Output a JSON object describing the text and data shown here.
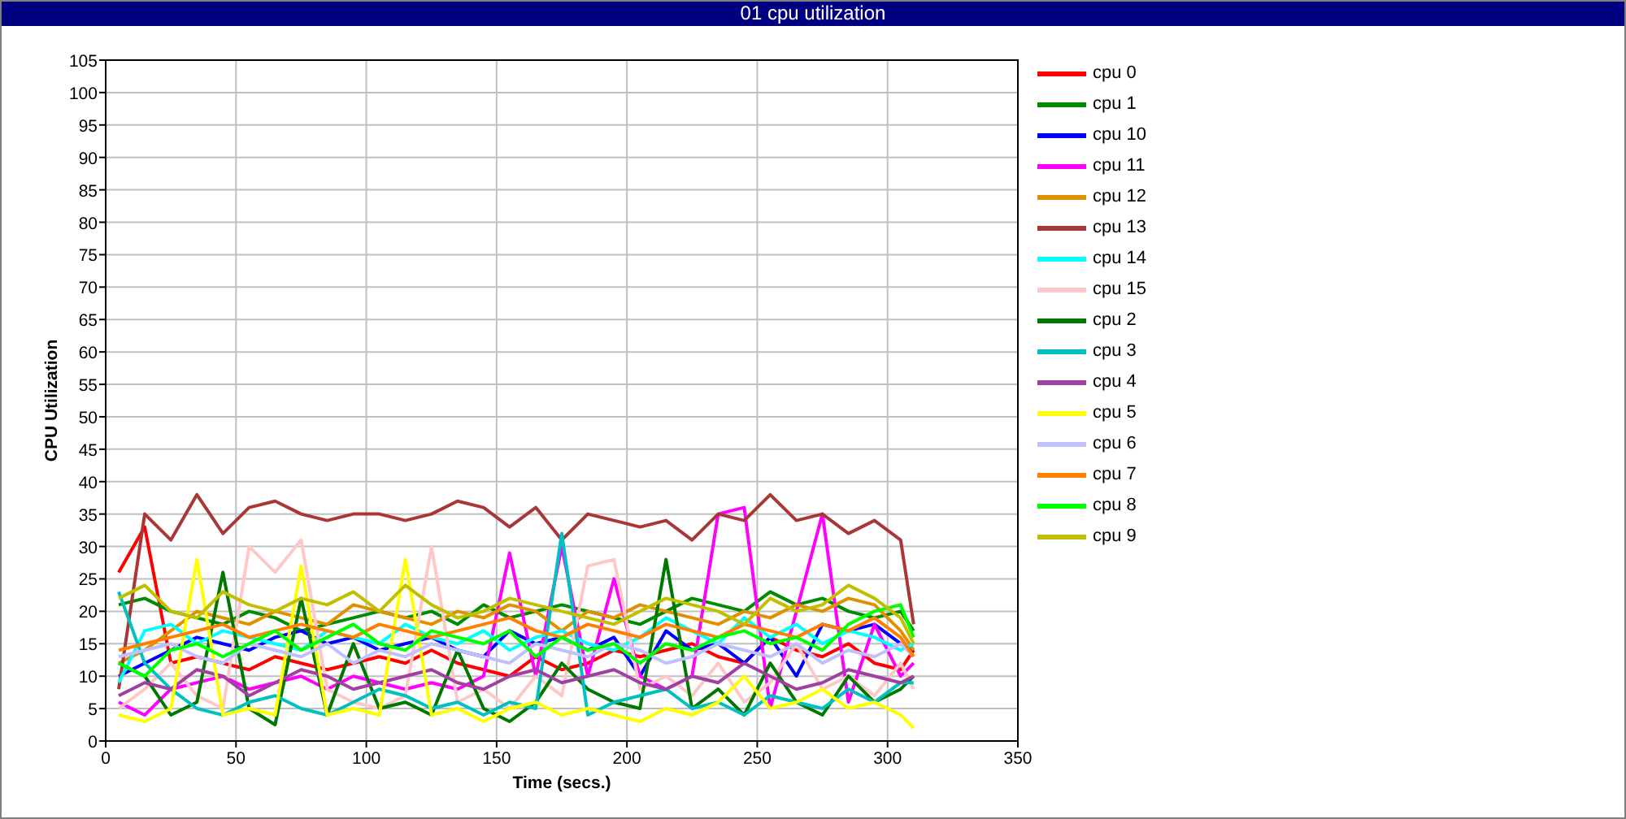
{
  "window": {
    "title": "01 cpu utilization"
  },
  "chart": {
    "chart_data": {
      "type": "line",
      "grid": true,
      "xlabel": "Time (secs.)",
      "ylabel": "CPU Utilization",
      "xlim": [
        0,
        350
      ],
      "ylim": [
        0,
        105
      ],
      "xticks": [
        0,
        50,
        100,
        150,
        200,
        250,
        300,
        350
      ],
      "yticks": [
        0,
        5,
        10,
        15,
        20,
        25,
        30,
        35,
        40,
        45,
        50,
        55,
        60,
        65,
        70,
        75,
        80,
        85,
        90,
        95,
        100,
        105
      ],
      "x": [
        5,
        15,
        25,
        35,
        45,
        55,
        65,
        75,
        85,
        95,
        105,
        115,
        125,
        135,
        145,
        155,
        165,
        175,
        185,
        195,
        205,
        215,
        225,
        235,
        245,
        255,
        265,
        275,
        285,
        295,
        305,
        310
      ],
      "series": [
        {
          "name": "cpu 0",
          "color": "#ff0000",
          "values": [
            26,
            33,
            12,
            13,
            12,
            11,
            13,
            12,
            11,
            12,
            13,
            12,
            14,
            12,
            11,
            10,
            13,
            11,
            12,
            14,
            13,
            14,
            15,
            13,
            12,
            16,
            14,
            13,
            15,
            12,
            11,
            14
          ]
        },
        {
          "name": "cpu 1",
          "color": "#008c00",
          "values": [
            21,
            22,
            20,
            19,
            18,
            20,
            19,
            17,
            18,
            19,
            20,
            19,
            20,
            18,
            21,
            19,
            20,
            21,
            20,
            19,
            18,
            20,
            22,
            21,
            20,
            23,
            21,
            22,
            20,
            19,
            20,
            17
          ]
        },
        {
          "name": "cpu 10",
          "color": "#0000ff",
          "values": [
            10,
            12,
            14,
            16,
            15,
            14,
            16,
            17,
            15,
            16,
            14,
            15,
            16,
            14,
            13,
            17,
            15,
            16,
            14,
            16,
            10,
            17,
            14,
            15,
            12,
            16,
            10,
            18,
            17,
            18,
            15,
            14
          ]
        },
        {
          "name": "cpu 11",
          "color": "#ff00ff",
          "values": [
            6,
            4,
            8,
            9,
            10,
            8,
            9,
            10,
            8,
            10,
            9,
            8,
            9,
            8,
            10,
            29,
            10,
            30,
            10,
            25,
            10,
            8,
            10,
            35,
            36,
            5,
            20,
            35,
            6,
            18,
            10,
            12
          ]
        },
        {
          "name": "cpu 12",
          "color": "#e09000",
          "values": [
            12,
            14,
            17,
            20,
            19,
            18,
            20,
            19,
            18,
            21,
            20,
            19,
            18,
            20,
            19,
            21,
            20,
            17,
            20,
            19,
            21,
            20,
            19,
            18,
            20,
            19,
            21,
            20,
            22,
            21,
            17,
            14
          ]
        },
        {
          "name": "cpu 13",
          "color": "#a83838",
          "values": [
            8,
            35,
            31,
            38,
            32,
            36,
            37,
            35,
            34,
            35,
            35,
            34,
            35,
            37,
            36,
            33,
            36,
            31,
            35,
            34,
            33,
            34,
            31,
            35,
            34,
            38,
            34,
            35,
            32,
            34,
            31,
            18
          ]
        },
        {
          "name": "cpu 14",
          "color": "#00ffff",
          "values": [
            9,
            17,
            18,
            15,
            17,
            16,
            15,
            14,
            17,
            16,
            15,
            18,
            16,
            15,
            17,
            14,
            16,
            17,
            15,
            14,
            16,
            19,
            17,
            15,
            19,
            16,
            18,
            15,
            17,
            16,
            14,
            15
          ]
        },
        {
          "name": "cpu 15",
          "color": "#ffc8c8",
          "values": [
            5,
            8,
            12,
            7,
            5,
            30,
            26,
            31,
            8,
            6,
            5,
            7,
            30,
            6,
            8,
            5,
            10,
            7,
            27,
            28,
            8,
            10,
            7,
            12,
            6,
            9,
            15,
            8,
            10,
            7,
            12,
            8
          ]
        },
        {
          "name": "cpu 2",
          "color": "#007800",
          "values": [
            12,
            10,
            4,
            6,
            26,
            5,
            2.5,
            22,
            4,
            15,
            5,
            6,
            4,
            14,
            5,
            3,
            6,
            12,
            8,
            6,
            5,
            28,
            5,
            8,
            4,
            12,
            6,
            4,
            10,
            6,
            8,
            10
          ]
        },
        {
          "name": "cpu 3",
          "color": "#00c0c0",
          "values": [
            23,
            12,
            8,
            5,
            4,
            6,
            7,
            5,
            4,
            6,
            8,
            7,
            5,
            6,
            4,
            6,
            5,
            32,
            4,
            6,
            7,
            8,
            5,
            6,
            4,
            7,
            6,
            5,
            8,
            6,
            9,
            9
          ]
        },
        {
          "name": "cpu 4",
          "color": "#a040a0",
          "values": [
            7,
            9,
            8,
            11,
            10,
            7,
            9,
            11,
            10,
            8,
            9,
            10,
            11,
            9,
            8,
            10,
            11,
            9,
            10,
            11,
            9,
            8,
            10,
            9,
            12,
            10,
            8,
            9,
            11,
            10,
            9,
            10
          ]
        },
        {
          "name": "cpu 5",
          "color": "#ffff00",
          "values": [
            4,
            3,
            5,
            28,
            4,
            5,
            4,
            27,
            4,
            5,
            4,
            28,
            4,
            5,
            3,
            5,
            6,
            4,
            5,
            4,
            3,
            5,
            4,
            6,
            10,
            5,
            6,
            8,
            5,
            6,
            4,
            2
          ]
        },
        {
          "name": "cpu 6",
          "color": "#c0c0ff",
          "values": [
            13,
            14,
            15,
            13,
            12,
            15,
            14,
            13,
            15,
            12,
            14,
            13,
            15,
            14,
            13,
            12,
            15,
            14,
            13,
            15,
            14,
            12,
            13,
            15,
            14,
            13,
            15,
            12,
            14,
            13,
            15,
            13
          ]
        },
        {
          "name": "cpu 7",
          "color": "#ff8000",
          "values": [
            14,
            15,
            16,
            17,
            18,
            16,
            17,
            18,
            17,
            16,
            18,
            17,
            16,
            17,
            18,
            19,
            17,
            16,
            18,
            17,
            16,
            18,
            17,
            16,
            18,
            17,
            16,
            18,
            17,
            19,
            16,
            13
          ]
        },
        {
          "name": "cpu 8",
          "color": "#00ff00",
          "values": [
            12,
            10,
            14,
            15,
            13,
            15,
            17,
            14,
            16,
            18,
            15,
            14,
            17,
            16,
            15,
            17,
            13,
            16,
            14,
            15,
            12,
            15,
            14,
            16,
            17,
            15,
            16,
            14,
            18,
            20,
            21,
            16
          ]
        },
        {
          "name": "cpu 9",
          "color": "#c0c000",
          "values": [
            22,
            24,
            20,
            19,
            23,
            21,
            20,
            22,
            21,
            23,
            20,
            24,
            21,
            19,
            20,
            22,
            21,
            20,
            19,
            18,
            20,
            22,
            21,
            20,
            18,
            22,
            20,
            21,
            24,
            22,
            19,
            15
          ]
        }
      ]
    }
  }
}
